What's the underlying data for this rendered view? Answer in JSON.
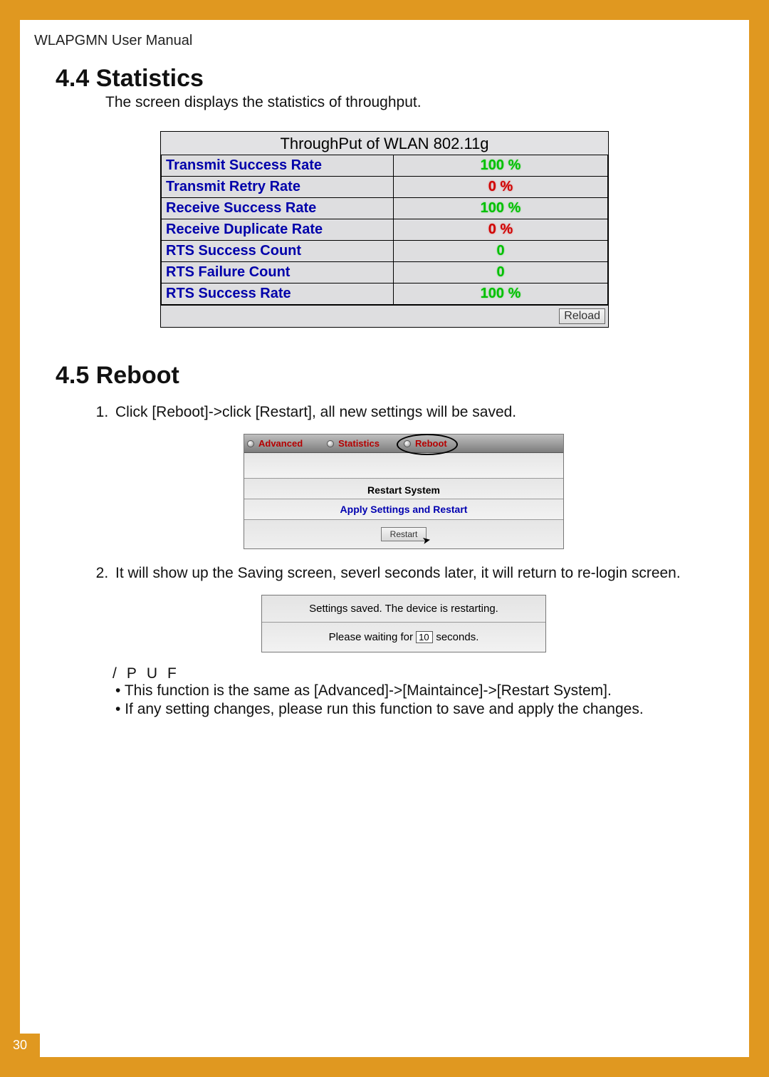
{
  "header": "WLAPGMN User Manual",
  "sec44": {
    "heading": "4.4  Statistics",
    "intro": "The screen displays the statistics of throughput.",
    "table_title": "ThroughPut of WLAN 802.11g",
    "rows": [
      {
        "label": "Transmit Success Rate",
        "value": "100 %",
        "cls": "val-green"
      },
      {
        "label": "Transmit Retry Rate",
        "value": "0 %",
        "cls": "val-red"
      },
      {
        "label": "Receive Success Rate",
        "value": "100 %",
        "cls": "val-green"
      },
      {
        "label": "Receive Duplicate Rate",
        "value": "0 %",
        "cls": "val-red"
      },
      {
        "label": "RTS Success Count",
        "value": "0",
        "cls": "val-green"
      },
      {
        "label": "RTS Failure Count",
        "value": "0",
        "cls": "val-green"
      },
      {
        "label": "RTS Success Rate",
        "value": "100 %",
        "cls": "val-green"
      }
    ],
    "reload_label": "Reload"
  },
  "sec45": {
    "heading": "4.5  Reboot",
    "step1": "Click [Reboot]->click [Restart], all new settings will be saved.",
    "step2": "It will show up the Saving screen, severl seconds later, it will return to re-login screen.",
    "tabs": {
      "advanced": "Advanced",
      "statistics": "Statistics",
      "reboot": "Reboot"
    },
    "restart_title": "Restart System",
    "apply_text": "Apply Settings and Restart",
    "restart_btn": "Restart",
    "saving_line1": "Settings saved. The device is restarting.",
    "saving_prefix": "Please waiting for",
    "saving_count": "10",
    "saving_suffix": "seconds.",
    "notes_head": "/PUF",
    "note1": "This function is the same as [Advanced]->[Maintaince]->[Restart System].",
    "note2": "If any setting changes, please run this function to save and apply the changes."
  },
  "page_number": "30"
}
